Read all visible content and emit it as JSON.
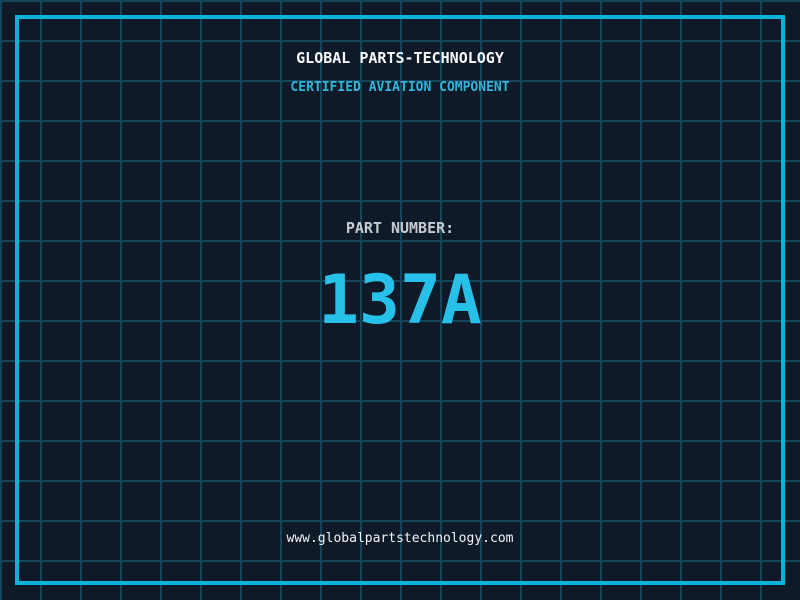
{
  "certificate": {
    "title": "GLOBAL PARTS-TECHNOLOGY",
    "subtitle": "CERTIFIED AVIATION COMPONENT",
    "part_label": "PART NUMBER:",
    "part_number": "137A",
    "website": "www.globalpartstechnology.com"
  },
  "colors": {
    "background": "#0f1a28",
    "grid_line": "#15455c",
    "border_accent": "#0cb2da",
    "title_text": "#f7f9fa",
    "subtitle_text": "#2fb6d9",
    "label_text": "#c6cbd2",
    "part_number_text": "#27c0e8",
    "website_text": "#f2f5f7"
  }
}
